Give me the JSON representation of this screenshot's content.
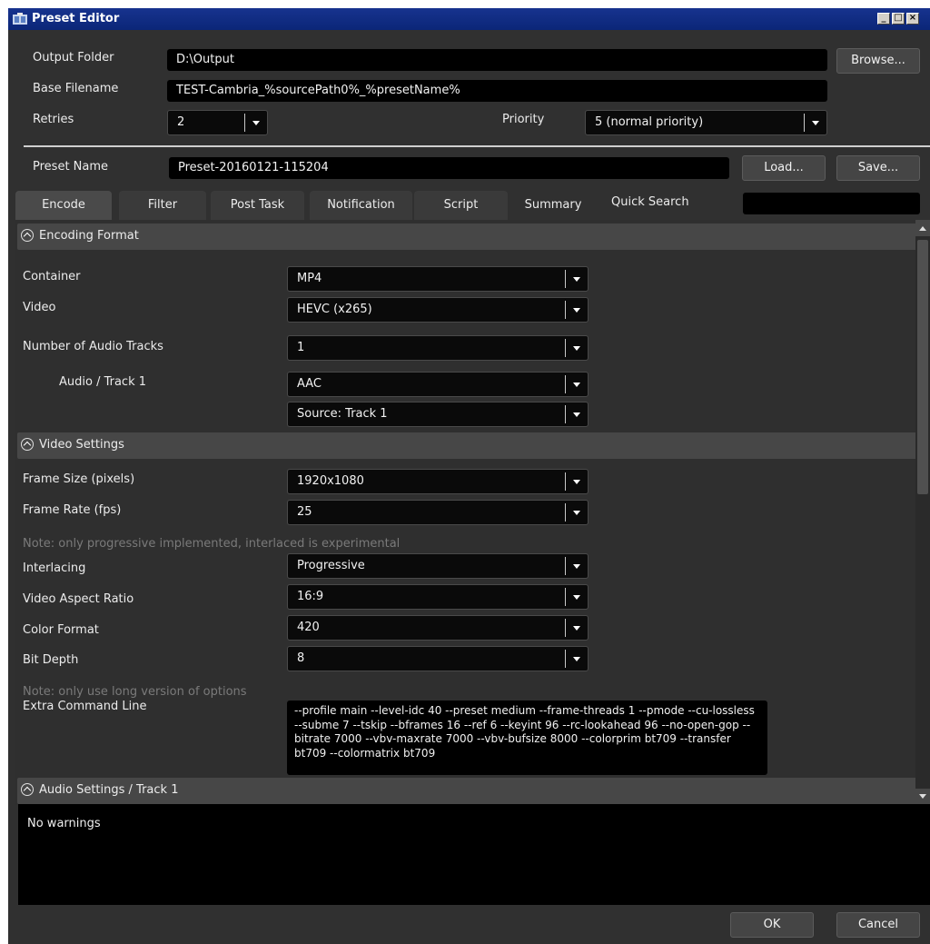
{
  "window": {
    "title": "Preset Editor"
  },
  "header": {
    "output_folder_label": "Output Folder",
    "output_folder_value": "D:\\Output",
    "browse_label": "Browse...",
    "base_filename_label": "Base Filename",
    "base_filename_value": "TEST-Cambria_%sourcePath0%_%presetName%",
    "retries_label": "Retries",
    "retries_value": "2",
    "priority_label": "Priority",
    "priority_value": "5 (normal priority)",
    "preset_name_label": "Preset Name",
    "preset_name_value": "Preset-20160121-115204",
    "load_label": "Load...",
    "save_label": "Save..."
  },
  "tabs": [
    "Encode",
    "Filter",
    "Post Task",
    "Notification",
    "Script",
    "Summary"
  ],
  "quick_search": {
    "label": "Quick Search",
    "value": ""
  },
  "encoding_format": {
    "title": "Encoding Format",
    "container_label": "Container",
    "container_value": "MP4",
    "video_label": "Video",
    "video_value": "HEVC (x265)",
    "audio_tracks_label": "Number of Audio Tracks",
    "audio_tracks_value": "1",
    "audio_track_label": "Audio / Track 1",
    "audio_codec_value": "AAC",
    "audio_source_value": "Source: Track 1"
  },
  "video_settings": {
    "title": "Video Settings",
    "frame_size_label": "Frame Size (pixels)",
    "frame_size_value": "1920x1080",
    "frame_rate_label": "Frame Rate (fps)",
    "frame_rate_value": "25",
    "interlace_note": "Note: only progressive implemented, interlaced is experimental",
    "interlacing_label": "Interlacing",
    "interlacing_value": "Progressive",
    "aspect_label": "Video Aspect Ratio",
    "aspect_value": "16:9",
    "color_label": "Color Format",
    "color_value": "420",
    "bitdepth_label": "Bit Depth",
    "bitdepth_value": "8",
    "options_note": "Note: only use long version of options",
    "extra_label": "Extra Command Line",
    "extra_value": "--profile main --level-idc 40 --preset medium --frame-threads 1 --pmode --cu-lossless --subme 7 --tskip --bframes 16 --ref 6 --keyint 96 --rc-lookahead 96 --no-open-gop --bitrate 7000 --vbv-maxrate 7000 --vbv-bufsize 8000 --colorprim bt709 --transfer bt709 --colormatrix bt709"
  },
  "audio_settings": {
    "title": "Audio Settings / Track 1"
  },
  "warnings": {
    "text": "No warnings"
  },
  "footer": {
    "ok_label": "OK",
    "cancel_label": "Cancel"
  }
}
